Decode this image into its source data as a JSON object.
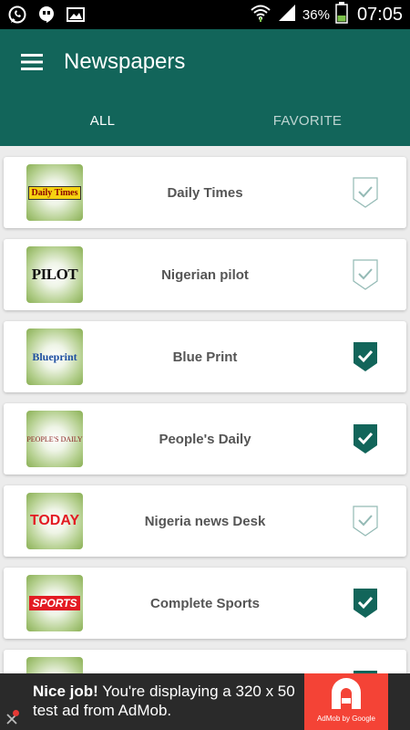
{
  "status_bar": {
    "battery_percent": "36%",
    "time": "07:05"
  },
  "toolbar": {
    "title": "Newspapers"
  },
  "tabs": [
    {
      "label": "ALL"
    },
    {
      "label": "FAVORITE"
    }
  ],
  "newspapers": [
    {
      "name": "Daily Times",
      "logo_text": "Daily Times",
      "favorite": false
    },
    {
      "name": "Nigerian pilot",
      "logo_text": "PILOT",
      "favorite": false
    },
    {
      "name": "Blue Print",
      "logo_text": "Blueprint",
      "favorite": true
    },
    {
      "name": "People's Daily",
      "logo_text": "PEOPLE'S DAILY",
      "favorite": true
    },
    {
      "name": "Nigeria news Desk",
      "logo_text": "TODAY",
      "favorite": false
    },
    {
      "name": "Complete Sports",
      "logo_text": "SPORTS",
      "favorite": true
    },
    {
      "name": "",
      "logo_text": "",
      "favorite": true
    }
  ],
  "ad": {
    "bold_text": "Nice job!",
    "text": " You're displaying a 320 x 50 test ad from AdMob.",
    "brand": "AdMob by Google"
  },
  "colors": {
    "primary": "#12655a",
    "ad_red": "#f44336"
  },
  "icons": {
    "menu": "hamburger-menu-icon",
    "favorite_on": "checked-badge-icon",
    "favorite_off": "unchecked-badge-icon"
  }
}
